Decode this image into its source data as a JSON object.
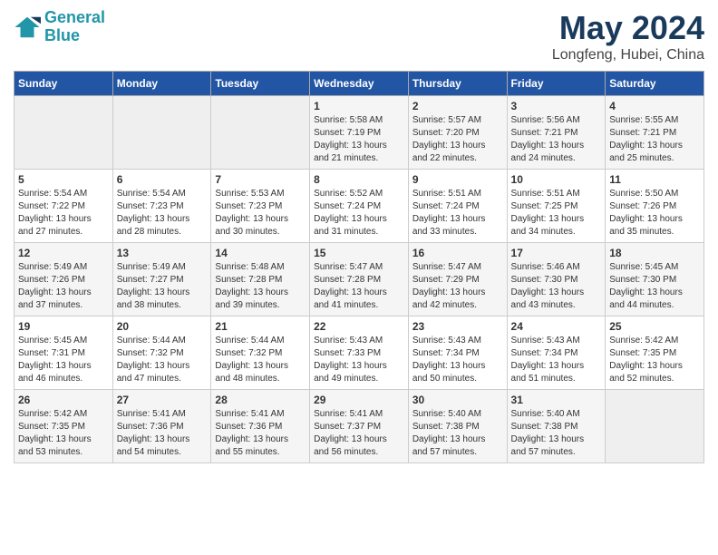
{
  "header": {
    "logo_line1": "General",
    "logo_line2": "Blue",
    "month": "May 2024",
    "location": "Longfeng, Hubei, China"
  },
  "weekdays": [
    "Sunday",
    "Monday",
    "Tuesday",
    "Wednesday",
    "Thursday",
    "Friday",
    "Saturday"
  ],
  "weeks": [
    [
      {
        "day": "",
        "info": ""
      },
      {
        "day": "",
        "info": ""
      },
      {
        "day": "",
        "info": ""
      },
      {
        "day": "1",
        "info": "Sunrise: 5:58 AM\nSunset: 7:19 PM\nDaylight: 13 hours\nand 21 minutes."
      },
      {
        "day": "2",
        "info": "Sunrise: 5:57 AM\nSunset: 7:20 PM\nDaylight: 13 hours\nand 22 minutes."
      },
      {
        "day": "3",
        "info": "Sunrise: 5:56 AM\nSunset: 7:21 PM\nDaylight: 13 hours\nand 24 minutes."
      },
      {
        "day": "4",
        "info": "Sunrise: 5:55 AM\nSunset: 7:21 PM\nDaylight: 13 hours\nand 25 minutes."
      }
    ],
    [
      {
        "day": "5",
        "info": "Sunrise: 5:54 AM\nSunset: 7:22 PM\nDaylight: 13 hours\nand 27 minutes."
      },
      {
        "day": "6",
        "info": "Sunrise: 5:54 AM\nSunset: 7:23 PM\nDaylight: 13 hours\nand 28 minutes."
      },
      {
        "day": "7",
        "info": "Sunrise: 5:53 AM\nSunset: 7:23 PM\nDaylight: 13 hours\nand 30 minutes."
      },
      {
        "day": "8",
        "info": "Sunrise: 5:52 AM\nSunset: 7:24 PM\nDaylight: 13 hours\nand 31 minutes."
      },
      {
        "day": "9",
        "info": "Sunrise: 5:51 AM\nSunset: 7:24 PM\nDaylight: 13 hours\nand 33 minutes."
      },
      {
        "day": "10",
        "info": "Sunrise: 5:51 AM\nSunset: 7:25 PM\nDaylight: 13 hours\nand 34 minutes."
      },
      {
        "day": "11",
        "info": "Sunrise: 5:50 AM\nSunset: 7:26 PM\nDaylight: 13 hours\nand 35 minutes."
      }
    ],
    [
      {
        "day": "12",
        "info": "Sunrise: 5:49 AM\nSunset: 7:26 PM\nDaylight: 13 hours\nand 37 minutes."
      },
      {
        "day": "13",
        "info": "Sunrise: 5:49 AM\nSunset: 7:27 PM\nDaylight: 13 hours\nand 38 minutes."
      },
      {
        "day": "14",
        "info": "Sunrise: 5:48 AM\nSunset: 7:28 PM\nDaylight: 13 hours\nand 39 minutes."
      },
      {
        "day": "15",
        "info": "Sunrise: 5:47 AM\nSunset: 7:28 PM\nDaylight: 13 hours\nand 41 minutes."
      },
      {
        "day": "16",
        "info": "Sunrise: 5:47 AM\nSunset: 7:29 PM\nDaylight: 13 hours\nand 42 minutes."
      },
      {
        "day": "17",
        "info": "Sunrise: 5:46 AM\nSunset: 7:30 PM\nDaylight: 13 hours\nand 43 minutes."
      },
      {
        "day": "18",
        "info": "Sunrise: 5:45 AM\nSunset: 7:30 PM\nDaylight: 13 hours\nand 44 minutes."
      }
    ],
    [
      {
        "day": "19",
        "info": "Sunrise: 5:45 AM\nSunset: 7:31 PM\nDaylight: 13 hours\nand 46 minutes."
      },
      {
        "day": "20",
        "info": "Sunrise: 5:44 AM\nSunset: 7:32 PM\nDaylight: 13 hours\nand 47 minutes."
      },
      {
        "day": "21",
        "info": "Sunrise: 5:44 AM\nSunset: 7:32 PM\nDaylight: 13 hours\nand 48 minutes."
      },
      {
        "day": "22",
        "info": "Sunrise: 5:43 AM\nSunset: 7:33 PM\nDaylight: 13 hours\nand 49 minutes."
      },
      {
        "day": "23",
        "info": "Sunrise: 5:43 AM\nSunset: 7:34 PM\nDaylight: 13 hours\nand 50 minutes."
      },
      {
        "day": "24",
        "info": "Sunrise: 5:43 AM\nSunset: 7:34 PM\nDaylight: 13 hours\nand 51 minutes."
      },
      {
        "day": "25",
        "info": "Sunrise: 5:42 AM\nSunset: 7:35 PM\nDaylight: 13 hours\nand 52 minutes."
      }
    ],
    [
      {
        "day": "26",
        "info": "Sunrise: 5:42 AM\nSunset: 7:35 PM\nDaylight: 13 hours\nand 53 minutes."
      },
      {
        "day": "27",
        "info": "Sunrise: 5:41 AM\nSunset: 7:36 PM\nDaylight: 13 hours\nand 54 minutes."
      },
      {
        "day": "28",
        "info": "Sunrise: 5:41 AM\nSunset: 7:36 PM\nDaylight: 13 hours\nand 55 minutes."
      },
      {
        "day": "29",
        "info": "Sunrise: 5:41 AM\nSunset: 7:37 PM\nDaylight: 13 hours\nand 56 minutes."
      },
      {
        "day": "30",
        "info": "Sunrise: 5:40 AM\nSunset: 7:38 PM\nDaylight: 13 hours\nand 57 minutes."
      },
      {
        "day": "31",
        "info": "Sunrise: 5:40 AM\nSunset: 7:38 PM\nDaylight: 13 hours\nand 57 minutes."
      },
      {
        "day": "",
        "info": ""
      }
    ]
  ]
}
